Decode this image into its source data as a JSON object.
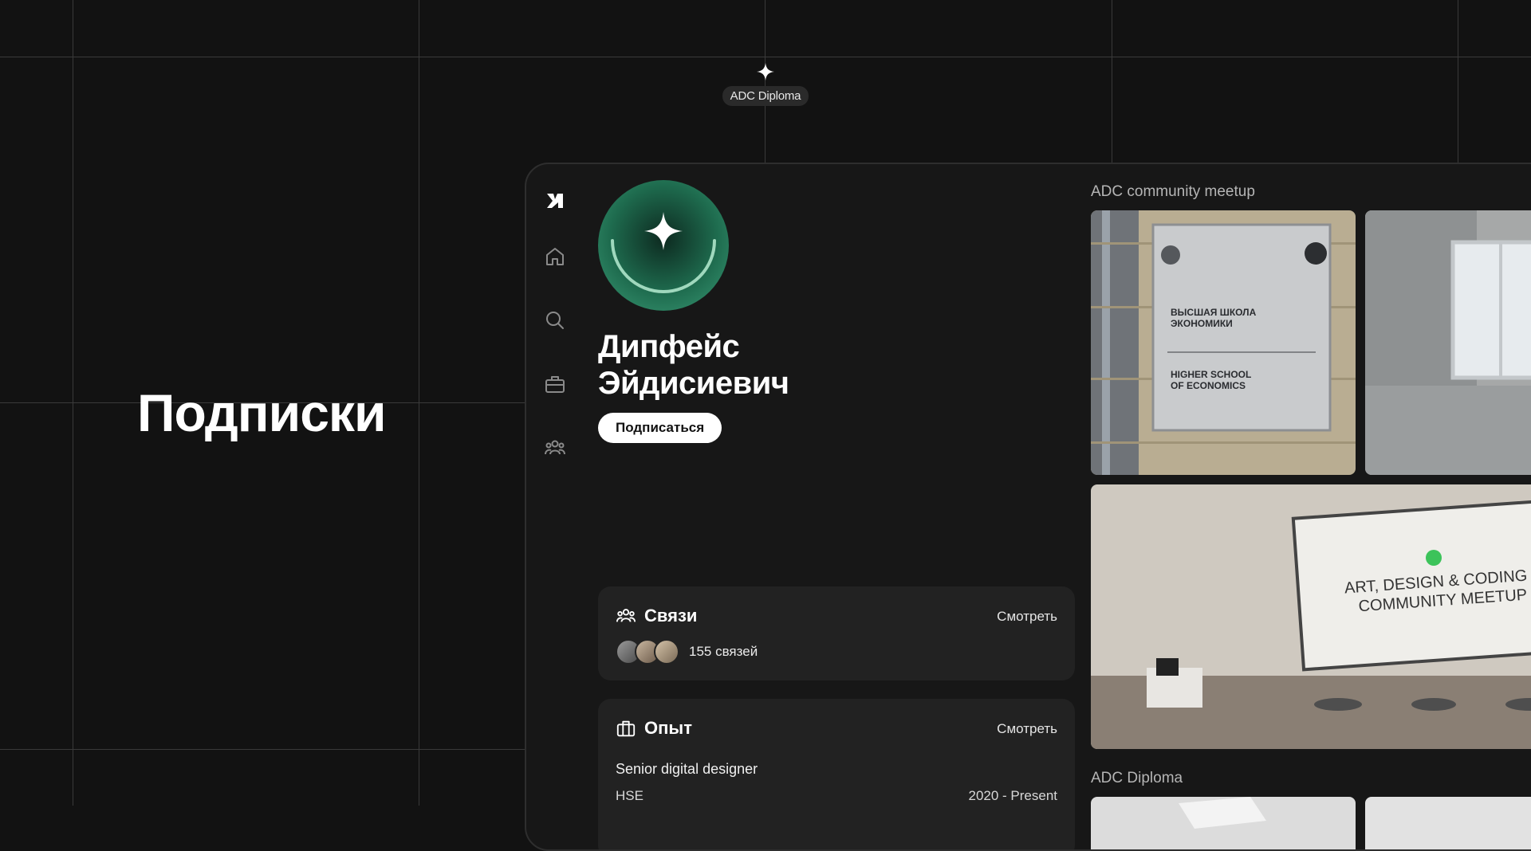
{
  "canvas": {
    "badge_label": "ADC Diploma",
    "badge_icon": "sparkle-icon",
    "hero_title": "Подписки"
  },
  "sidebar": {
    "items": [
      {
        "icon": "logo-icon",
        "name": "logo"
      },
      {
        "icon": "home-icon",
        "name": "home"
      },
      {
        "icon": "search-icon",
        "name": "search"
      },
      {
        "icon": "briefcase-icon",
        "name": "jobs"
      },
      {
        "icon": "people-icon",
        "name": "community"
      }
    ]
  },
  "profile": {
    "name": "Дипфейс Эйдисиевич",
    "subscribe_label": "Подписаться",
    "avatar_color": "#2f8f68"
  },
  "connections": {
    "title": "Связи",
    "link": "Смотреть",
    "count_label": "155 связей"
  },
  "experience": {
    "title": "Опыт",
    "link": "Смотреть",
    "role": "Senior digital designer",
    "org": "HSE",
    "period": "2020 - Present"
  },
  "gallery": {
    "sections": [
      {
        "title": "ADC community meetup"
      },
      {
        "title": "ADC Diploma"
      }
    ],
    "plaque": {
      "line1": "ВЫСШАЯ ШКОЛА",
      "line2": "ЭКОНОМИКИ",
      "line3": "HIGHER SCHOOL",
      "line4": "OF ECONOMICS"
    },
    "screen": {
      "line1": "ART, DESIGN & CODING",
      "line2": "COMMUNITY MEETUP"
    }
  },
  "colors": {
    "background": "#121212",
    "card": "#222222",
    "accent_green": "#2f8f68"
  }
}
